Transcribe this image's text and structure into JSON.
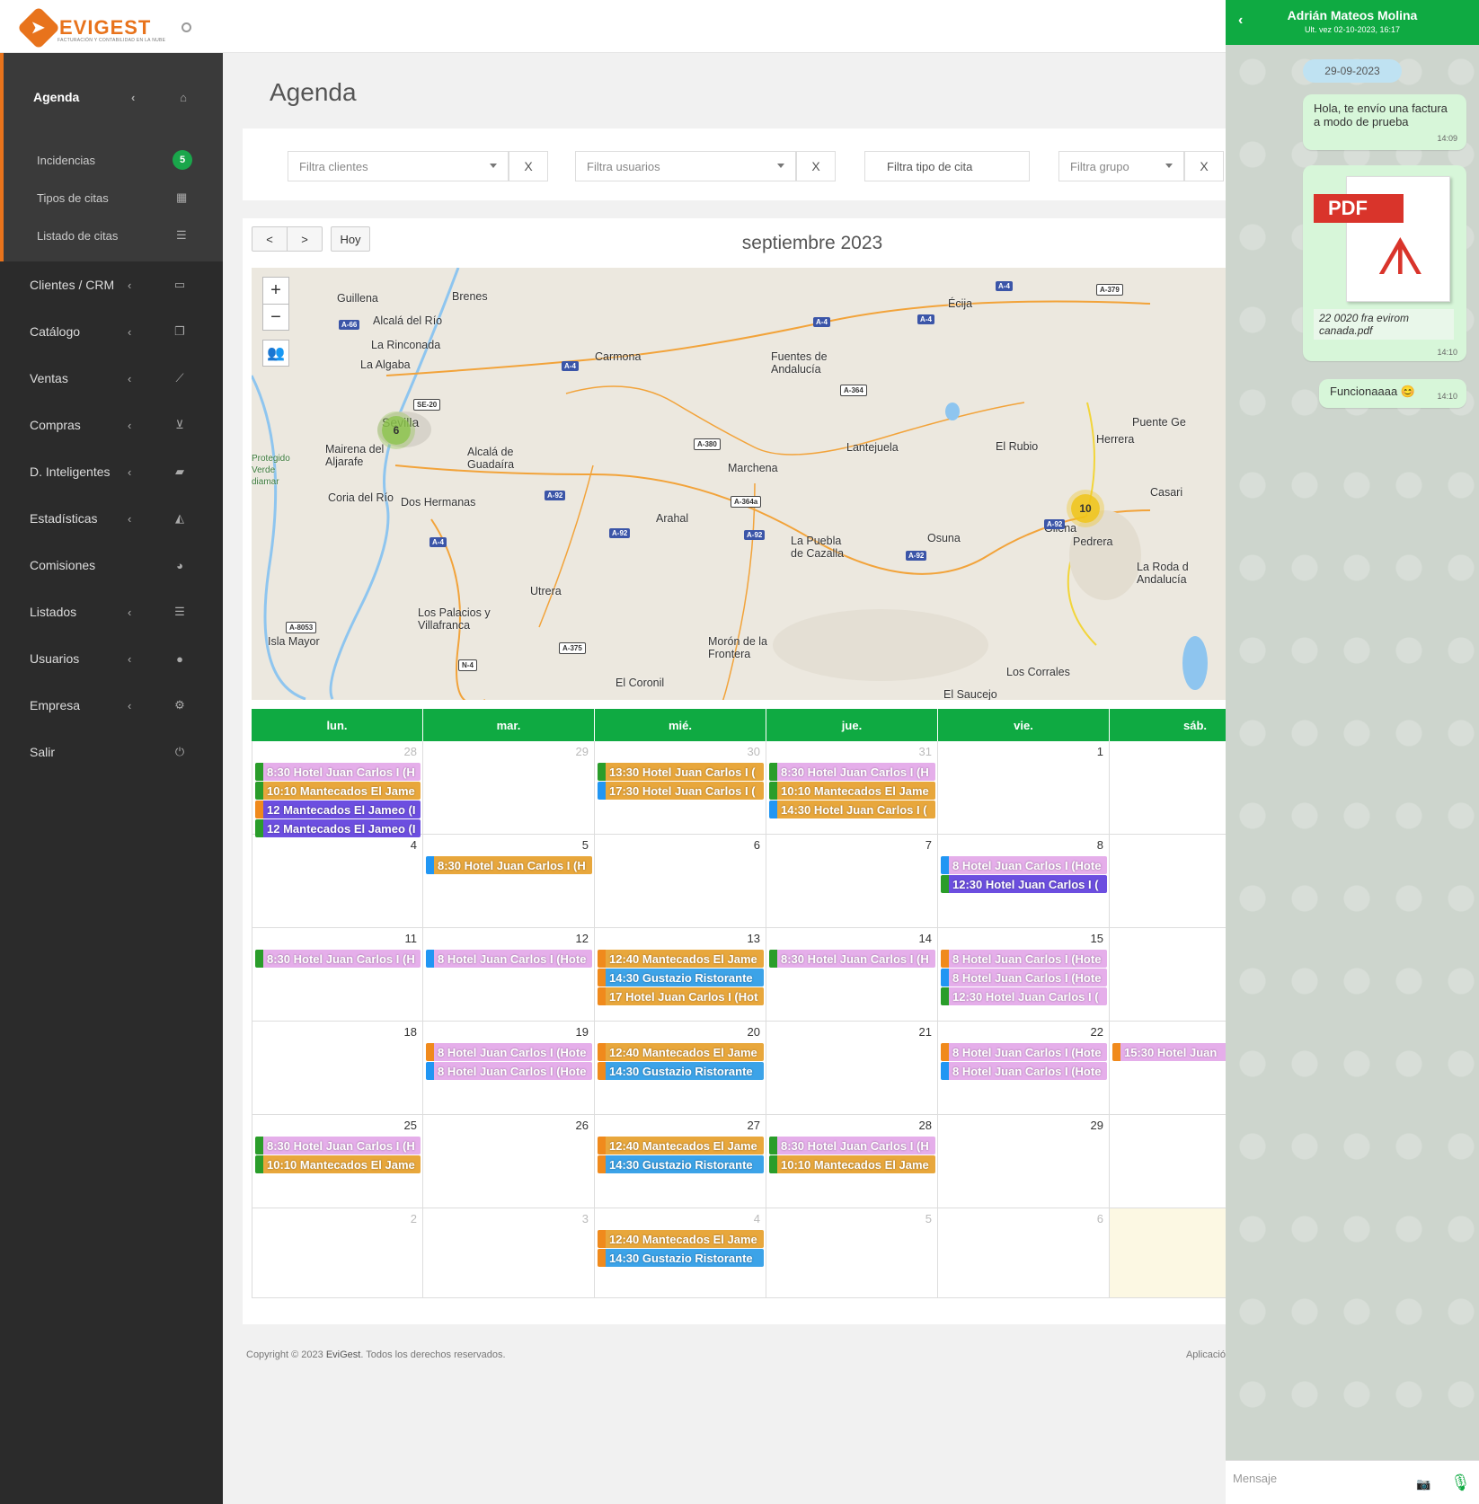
{
  "header": {
    "brand": "EVIGEST",
    "brand_sub": "FACTURACIÓN Y CONTABILIDAD EN LA NUBE"
  },
  "sidebar": {
    "active": {
      "label": "Agenda"
    },
    "sub_items": [
      {
        "label": "Incidencias",
        "badge": "5"
      },
      {
        "label": "Tipos de citas"
      },
      {
        "label": "Listado de citas"
      }
    ],
    "items": [
      {
        "label": "Clientes / CRM"
      },
      {
        "label": "Catálogo"
      },
      {
        "label": "Ventas"
      },
      {
        "label": "Compras"
      },
      {
        "label": "D. Inteligentes"
      },
      {
        "label": "Estadísticas"
      },
      {
        "label": "Comisiones"
      },
      {
        "label": "Listados"
      },
      {
        "label": "Usuarios"
      },
      {
        "label": "Empresa"
      },
      {
        "label": "Salir"
      }
    ]
  },
  "page": {
    "title": "Agenda"
  },
  "filters": {
    "clients_placeholder": "Filtra clientes",
    "users_placeholder": "Filtra usuarios",
    "type_placeholder": "Filtra tipo de cita",
    "group_placeholder": "Filtra grupo",
    "clear_label": "X"
  },
  "calendar": {
    "title": "septiembre 2023",
    "today_label": "Hoy",
    "prev": "<",
    "next": ">",
    "day_headers": [
      "lun.",
      "mar.",
      "mié.",
      "jue.",
      "vie.",
      "sáb."
    ],
    "weeks": [
      [
        {
          "n": "28",
          "other": true,
          "events": [
            {
              "text": "8:30 Hotel Juan Carlos I (H",
              "c": "pink",
              "l": "lg"
            },
            {
              "text": "10:10 Mantecados El Jame",
              "c": "orange",
              "l": "lg"
            },
            {
              "text": "12 Mantecados El Jameo (I",
              "c": "purple",
              "l": "lo"
            },
            {
              "text": "12 Mantecados El Jameo (I",
              "c": "purple",
              "l": "lg"
            }
          ]
        },
        {
          "n": "29",
          "other": true,
          "events": []
        },
        {
          "n": "30",
          "other": true,
          "events": [
            {
              "text": "13:30 Hotel Juan Carlos I (",
              "c": "orange",
              "l": "lg"
            },
            {
              "text": "17:30 Hotel Juan Carlos I (",
              "c": "orange",
              "l": "lb"
            }
          ]
        },
        {
          "n": "31",
          "other": true,
          "events": [
            {
              "text": "8:30 Hotel Juan Carlos I (H",
              "c": "pink",
              "l": "lg"
            },
            {
              "text": "10:10 Mantecados El Jame",
              "c": "orange",
              "l": "lg"
            },
            {
              "text": "14:30 Hotel Juan Carlos I (",
              "c": "orange",
              "l": "lb"
            }
          ]
        },
        {
          "n": "1",
          "other": false,
          "events": []
        },
        {
          "n": "",
          "other": false,
          "events": []
        }
      ],
      [
        {
          "n": "4",
          "other": false,
          "events": []
        },
        {
          "n": "5",
          "other": false,
          "events": [
            {
              "text": "8:30 Hotel Juan Carlos I (H",
              "c": "orange",
              "l": "lb"
            }
          ]
        },
        {
          "n": "6",
          "other": false,
          "events": []
        },
        {
          "n": "7",
          "other": false,
          "events": []
        },
        {
          "n": "8",
          "other": false,
          "events": [
            {
              "text": "8 Hotel Juan Carlos I (Hote",
              "c": "pink",
              "l": "lb"
            },
            {
              "text": "12:30 Hotel Juan Carlos I (",
              "c": "purple",
              "l": "lg"
            }
          ]
        },
        {
          "n": "",
          "other": false,
          "events": []
        }
      ],
      [
        {
          "n": "11",
          "other": false,
          "events": [
            {
              "text": "8:30 Hotel Juan Carlos I (H",
              "c": "pink",
              "l": "lg"
            }
          ]
        },
        {
          "n": "12",
          "other": false,
          "events": [
            {
              "text": "8 Hotel Juan Carlos I (Hote",
              "c": "pink",
              "l": "lb"
            }
          ]
        },
        {
          "n": "13",
          "other": false,
          "events": [
            {
              "text": "12:40 Mantecados El Jame",
              "c": "orange",
              "l": "lo"
            },
            {
              "text": "14:30 Gustazio Ristorante",
              "c": "blue",
              "l": "lo"
            },
            {
              "text": "17 Hotel Juan Carlos I (Hot",
              "c": "orange",
              "l": "lo"
            }
          ]
        },
        {
          "n": "14",
          "other": false,
          "events": [
            {
              "text": "8:30 Hotel Juan Carlos I (H",
              "c": "pink",
              "l": "lg"
            }
          ]
        },
        {
          "n": "15",
          "other": false,
          "events": [
            {
              "text": "8 Hotel Juan Carlos I (Hote",
              "c": "pink",
              "l": "lo"
            },
            {
              "text": "8 Hotel Juan Carlos I (Hote",
              "c": "pink",
              "l": "lb"
            },
            {
              "text": "12:30 Hotel Juan Carlos I (",
              "c": "pink",
              "l": "lg"
            }
          ]
        },
        {
          "n": "",
          "other": false,
          "events": []
        }
      ],
      [
        {
          "n": "18",
          "other": false,
          "events": []
        },
        {
          "n": "19",
          "other": false,
          "events": [
            {
              "text": "8 Hotel Juan Carlos I (Hote",
              "c": "pink",
              "l": "lo"
            },
            {
              "text": "8 Hotel Juan Carlos I (Hote",
              "c": "pink",
              "l": "lb"
            }
          ]
        },
        {
          "n": "20",
          "other": false,
          "events": [
            {
              "text": "12:40 Mantecados El Jame",
              "c": "orange",
              "l": "lo"
            },
            {
              "text": "14:30 Gustazio Ristorante",
              "c": "blue",
              "l": "lo"
            }
          ]
        },
        {
          "n": "21",
          "other": false,
          "events": []
        },
        {
          "n": "22",
          "other": false,
          "events": [
            {
              "text": "8 Hotel Juan Carlos I (Hote",
              "c": "pink",
              "l": "lo"
            },
            {
              "text": "8 Hotel Juan Carlos I (Hote",
              "c": "pink",
              "l": "lb"
            }
          ]
        },
        {
          "n": "",
          "other": false,
          "events": [
            {
              "text": "15:30 Hotel Juan",
              "c": "pink",
              "l": "lo"
            }
          ]
        }
      ],
      [
        {
          "n": "25",
          "other": false,
          "events": [
            {
              "text": "8:30 Hotel Juan Carlos I (H",
              "c": "pink",
              "l": "lg"
            },
            {
              "text": "10:10 Mantecados El Jame",
              "c": "orange",
              "l": "lg"
            }
          ]
        },
        {
          "n": "26",
          "other": false,
          "events": []
        },
        {
          "n": "27",
          "other": false,
          "events": [
            {
              "text": "12:40 Mantecados El Jame",
              "c": "orange",
              "l": "lo"
            },
            {
              "text": "14:30 Gustazio Ristorante",
              "c": "blue",
              "l": "lo"
            }
          ]
        },
        {
          "n": "28",
          "other": false,
          "events": [
            {
              "text": "8:30 Hotel Juan Carlos I (H",
              "c": "pink",
              "l": "lg"
            },
            {
              "text": "10:10 Mantecados El Jame",
              "c": "orange",
              "l": "lg"
            }
          ]
        },
        {
          "n": "29",
          "other": false,
          "events": []
        },
        {
          "n": "",
          "other": false,
          "events": []
        }
      ],
      [
        {
          "n": "2",
          "other": true,
          "events": []
        },
        {
          "n": "3",
          "other": true,
          "events": []
        },
        {
          "n": "4",
          "other": true,
          "events": [
            {
              "text": "12:40 Mantecados El Jame",
              "c": "orange",
              "l": "lo"
            },
            {
              "text": "14:30 Gustazio Ristorante",
              "c": "blue",
              "l": "lo"
            }
          ]
        },
        {
          "n": "5",
          "other": true,
          "events": []
        },
        {
          "n": "6",
          "other": true,
          "events": []
        },
        {
          "n": "",
          "other": false,
          "today": true,
          "events": []
        }
      ]
    ]
  },
  "map": {
    "zoom_in": "+",
    "zoom_out": "−",
    "clusters": [
      {
        "count": "6",
        "color": "#8bc34a"
      },
      {
        "count": "10",
        "color": "#f0c419"
      }
    ],
    "places": [
      "Guillena",
      "Brenes",
      "Alcalá del Río",
      "La Rinconada",
      "La Algaba",
      "Carmona",
      "Fuentes de Andalucía",
      "Écija",
      "Mairena del Aljarafe",
      "Alcalá de Guadaíra",
      "Coria del Río",
      "Dos Hermanas",
      "Marchena",
      "Lantejuela",
      "El Rubio",
      "Herrera",
      "Puente Ge",
      "Arahal",
      "La Puebla de Cazalla",
      "Osuna",
      "Gilena",
      "Pedrera",
      "Casari",
      "La Roda d Andalucía",
      "Utrera",
      "Los Palacios y Villafranca",
      "Morón de la Frontera",
      "El Coronil",
      "Los Corrales",
      "El Saucejo",
      "Isla Mayor",
      "Sevilla",
      "Protegido Verde diamar"
    ],
    "roads": [
      "A-66",
      "SE-20",
      "A-4",
      "A-4",
      "A-4",
      "A-4",
      "A-364",
      "A-380",
      "A-92",
      "A-92",
      "A-92",
      "A-92",
      "A-92",
      "A-364a",
      "A-4",
      "A-8053",
      "A-375",
      "N-4",
      "A-379"
    ]
  },
  "footer": {
    "copyright": "Copyright © 2023",
    "brand": "EviGest",
    "rights": ". Todos los derechos reservados.",
    "right": "Aplicació"
  },
  "chat": {
    "name": "Adrián Mateos Molina",
    "last_seen": "Ult. vez 02-10-2023, 16:17",
    "date": "29-09-2023",
    "messages": [
      {
        "text": "Hola, te envío una factura a modo de prueba",
        "time": "14:09"
      },
      {
        "file": "22 0020 fra evirom canada.pdf",
        "label": "PDF",
        "time": "14:10"
      },
      {
        "text": "Funcionaaaa 😊",
        "time": "14:10"
      }
    ],
    "input_placeholder": "Mensaje"
  }
}
